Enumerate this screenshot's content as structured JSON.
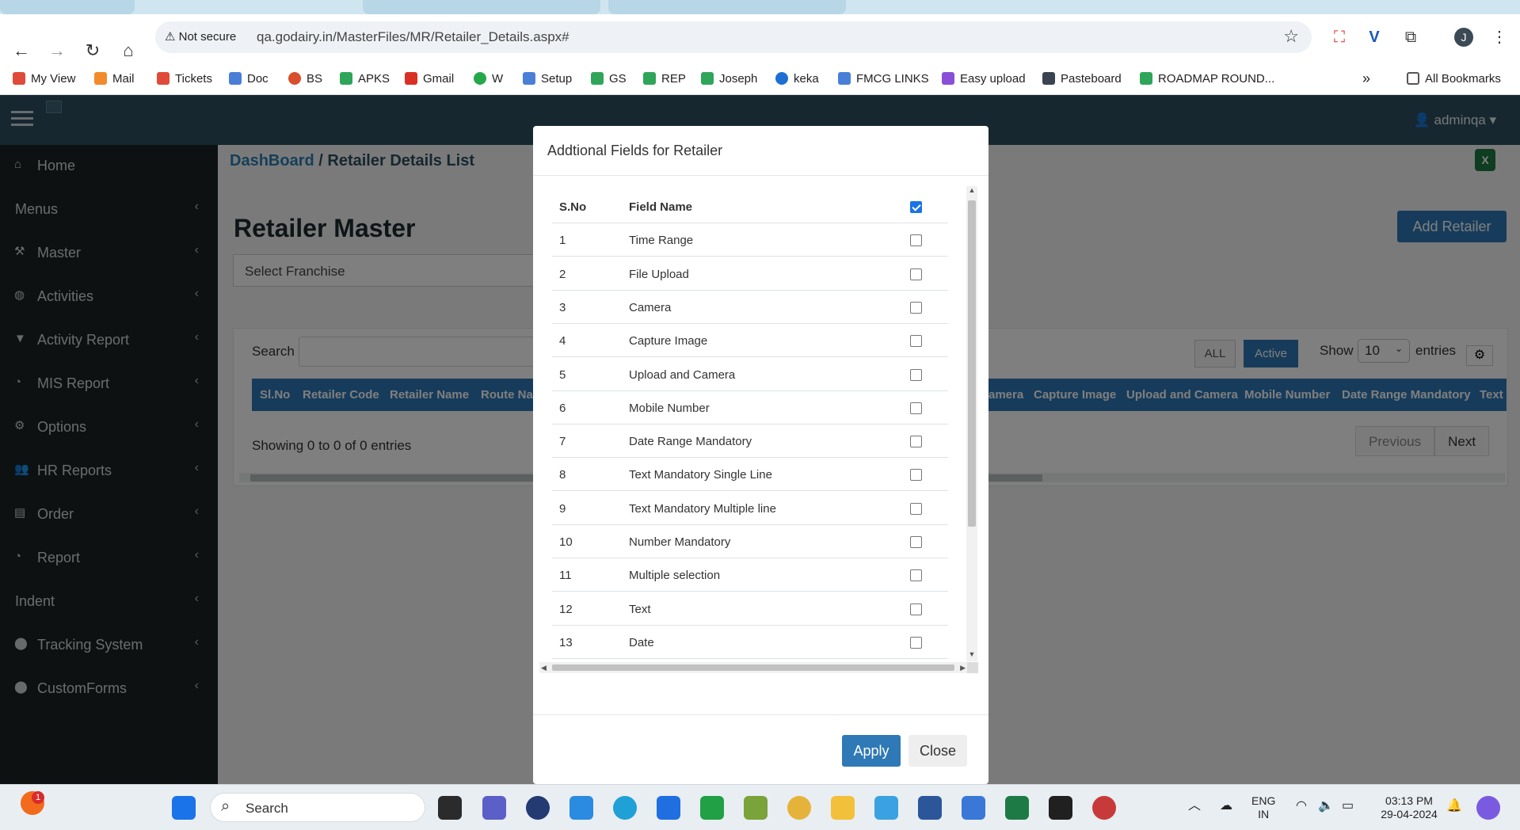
{
  "browser": {
    "not_secure": "Not secure",
    "url": "qa.godairy.in/MasterFiles/MR/Retailer_Details.aspx#",
    "bookmarks": [
      "My View",
      "Mail",
      "Tickets",
      "Doc",
      "BS",
      "APKS",
      "Gmail",
      "W",
      "Setup",
      "GS",
      "REP",
      "Joseph",
      "keka",
      "FMCG LINKS",
      "Easy upload",
      "Pasteboard",
      "ROADMAP ROUND..."
    ],
    "all_bookmarks": "All Bookmarks",
    "profile_initial": "J"
  },
  "app": {
    "user": "adminqa",
    "breadcrumb_link": "DashBoard",
    "breadcrumb_sep": "/",
    "breadcrumb_current": "Retailer Details List",
    "page_title": "Retailer Master",
    "add_button": "Add Retailer",
    "franchise_placeholder": "Select Franchise",
    "search_label": "Search",
    "filter_all": "ALL",
    "filter_active": "Active",
    "show_label": "Show",
    "show_value": "10",
    "entries_label": "entries",
    "columns_left": [
      "Sl.No",
      "Retailer Code",
      "Retailer Name",
      "Route Na"
    ],
    "columns_right": [
      "amera",
      "Capture Image",
      "Upload and Camera",
      "Mobile Number",
      "Date Range Mandatory",
      "Text"
    ],
    "showing_text": "Showing 0 to 0 of 0 entries",
    "previous": "Previous",
    "next": "Next"
  },
  "sidebar": {
    "items": [
      {
        "label": "Home",
        "icon": "home-icon",
        "chevron": false
      },
      {
        "label": "Menus",
        "icon": "",
        "chevron": true
      },
      {
        "label": "Master",
        "icon": "gavel-icon",
        "chevron": true
      },
      {
        "label": "Activities",
        "icon": "globe-icon",
        "chevron": true
      },
      {
        "label": "Activity Report",
        "icon": "filter-icon",
        "chevron": true
      },
      {
        "label": "MIS Report",
        "icon": "dashboard-icon",
        "chevron": true
      },
      {
        "label": "Options",
        "icon": "gears-icon",
        "chevron": true
      },
      {
        "label": "HR Reports",
        "icon": "users-icon",
        "chevron": true
      },
      {
        "label": "Order",
        "icon": "file-icon",
        "chevron": true
      },
      {
        "label": "Report",
        "icon": "dashboard-icon",
        "chevron": true
      },
      {
        "label": "Indent",
        "icon": "",
        "chevron": true
      },
      {
        "label": "Tracking System",
        "icon": "map-marker-icon",
        "chevron": true
      },
      {
        "label": "CustomForms",
        "icon": "map-marker-icon",
        "chevron": true
      }
    ]
  },
  "modal": {
    "title": "Addtional Fields for Retailer",
    "col_sno": "S.No",
    "col_field": "Field Name",
    "rows": [
      {
        "sno": "1",
        "field": "Time Range"
      },
      {
        "sno": "2",
        "field": "File Upload"
      },
      {
        "sno": "3",
        "field": "Camera"
      },
      {
        "sno": "4",
        "field": "Capture Image"
      },
      {
        "sno": "5",
        "field": "Upload and Camera"
      },
      {
        "sno": "6",
        "field": "Mobile Number"
      },
      {
        "sno": "7",
        "field": "Date Range Mandatory"
      },
      {
        "sno": "8",
        "field": "Text Mandatory Single Line"
      },
      {
        "sno": "9",
        "field": "Text Mandatory Multiple line"
      },
      {
        "sno": "10",
        "field": "Number Mandatory"
      },
      {
        "sno": "11",
        "field": "Multiple selection"
      },
      {
        "sno": "12",
        "field": "Text"
      },
      {
        "sno": "13",
        "field": "Date"
      }
    ],
    "apply": "Apply",
    "close": "Close"
  },
  "taskbar": {
    "search": "Search",
    "lang_top": "ENG",
    "lang_bottom": "IN",
    "time": "03:13 PM",
    "date": "29-04-2024",
    "badge": "1"
  }
}
